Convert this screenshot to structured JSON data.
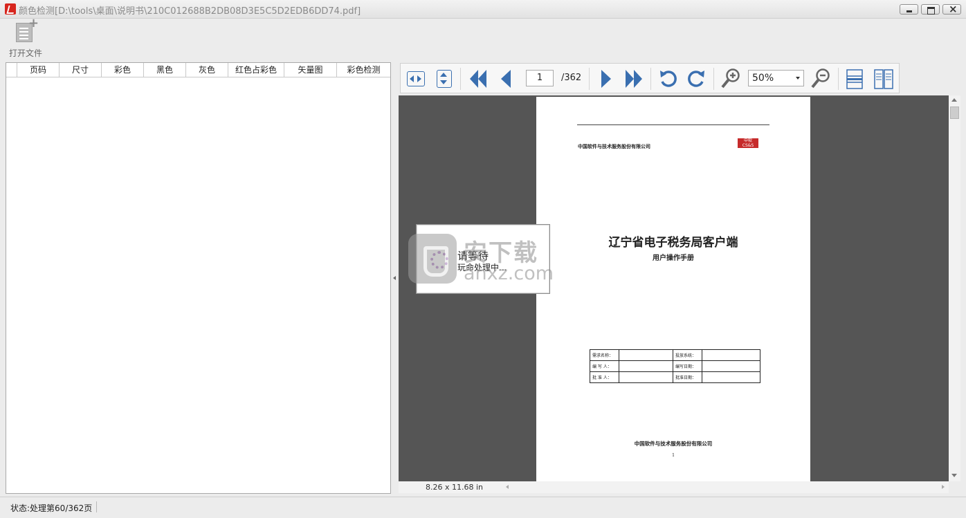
{
  "window": {
    "title": "颜色检测[D:\\tools\\桌面\\说明书\\210C012688B2DB08D3E5C5D2EDB6DD74.pdf]"
  },
  "toolbar": {
    "open_file_label": "打开文件"
  },
  "table": {
    "columns": [
      "",
      "页码",
      "尺寸",
      "彩色",
      "黑色",
      "灰色",
      "红色占彩色",
      "矢量图",
      "彩色检测"
    ],
    "rows": []
  },
  "viewer_toolbar": {
    "current_page": "1",
    "total_pages": "/362",
    "zoom": "50%"
  },
  "document_page": {
    "company_header": "中国软件与技术服务股份有限公司",
    "logo_text": "中软 CS&S",
    "title": "辽宁省电子税务局客户端",
    "subtitle": "用户操作手册",
    "info_table": [
      [
        "需求名称：",
        "",
        "投放系统：",
        ""
      ],
      [
        "编 写 人：",
        "",
        "编写日期：",
        ""
      ],
      [
        "批 准 人：",
        "",
        "批准日期：",
        ""
      ]
    ],
    "company_footer": "中国软件与技术服务股份有限公司",
    "page_number": "1"
  },
  "page_size": "8.26 x 11.68 in",
  "wait_dialog": {
    "title": "请等待",
    "message": "玩命处理中..."
  },
  "watermark": {
    "cn": "安下载",
    "en": "anxz.com"
  },
  "status": {
    "text": "状态:处理第60/362页"
  },
  "colors": {
    "viewer_background": "#555555",
    "nav_blue": "#3a6fb0",
    "app_red": "#d7261e"
  }
}
